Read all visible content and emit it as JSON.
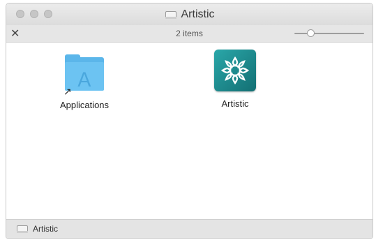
{
  "window": {
    "title": "Artistic",
    "title_icon": "disk-icon"
  },
  "toolbar": {
    "close_glyph": "✕",
    "items_count": "2 items",
    "icon_size_slider": {
      "value": 0.2
    }
  },
  "files": [
    {
      "name": "Applications",
      "icon": "applications-folder-icon",
      "alias": true
    },
    {
      "name": "Artistic",
      "icon": "artistic-app-icon",
      "alias": false
    }
  ],
  "statusbar": {
    "path": "Artistic",
    "icon": "disk-icon"
  },
  "colors": {
    "folder": "#5bb6ea",
    "app_icon": "#1f8f92"
  }
}
